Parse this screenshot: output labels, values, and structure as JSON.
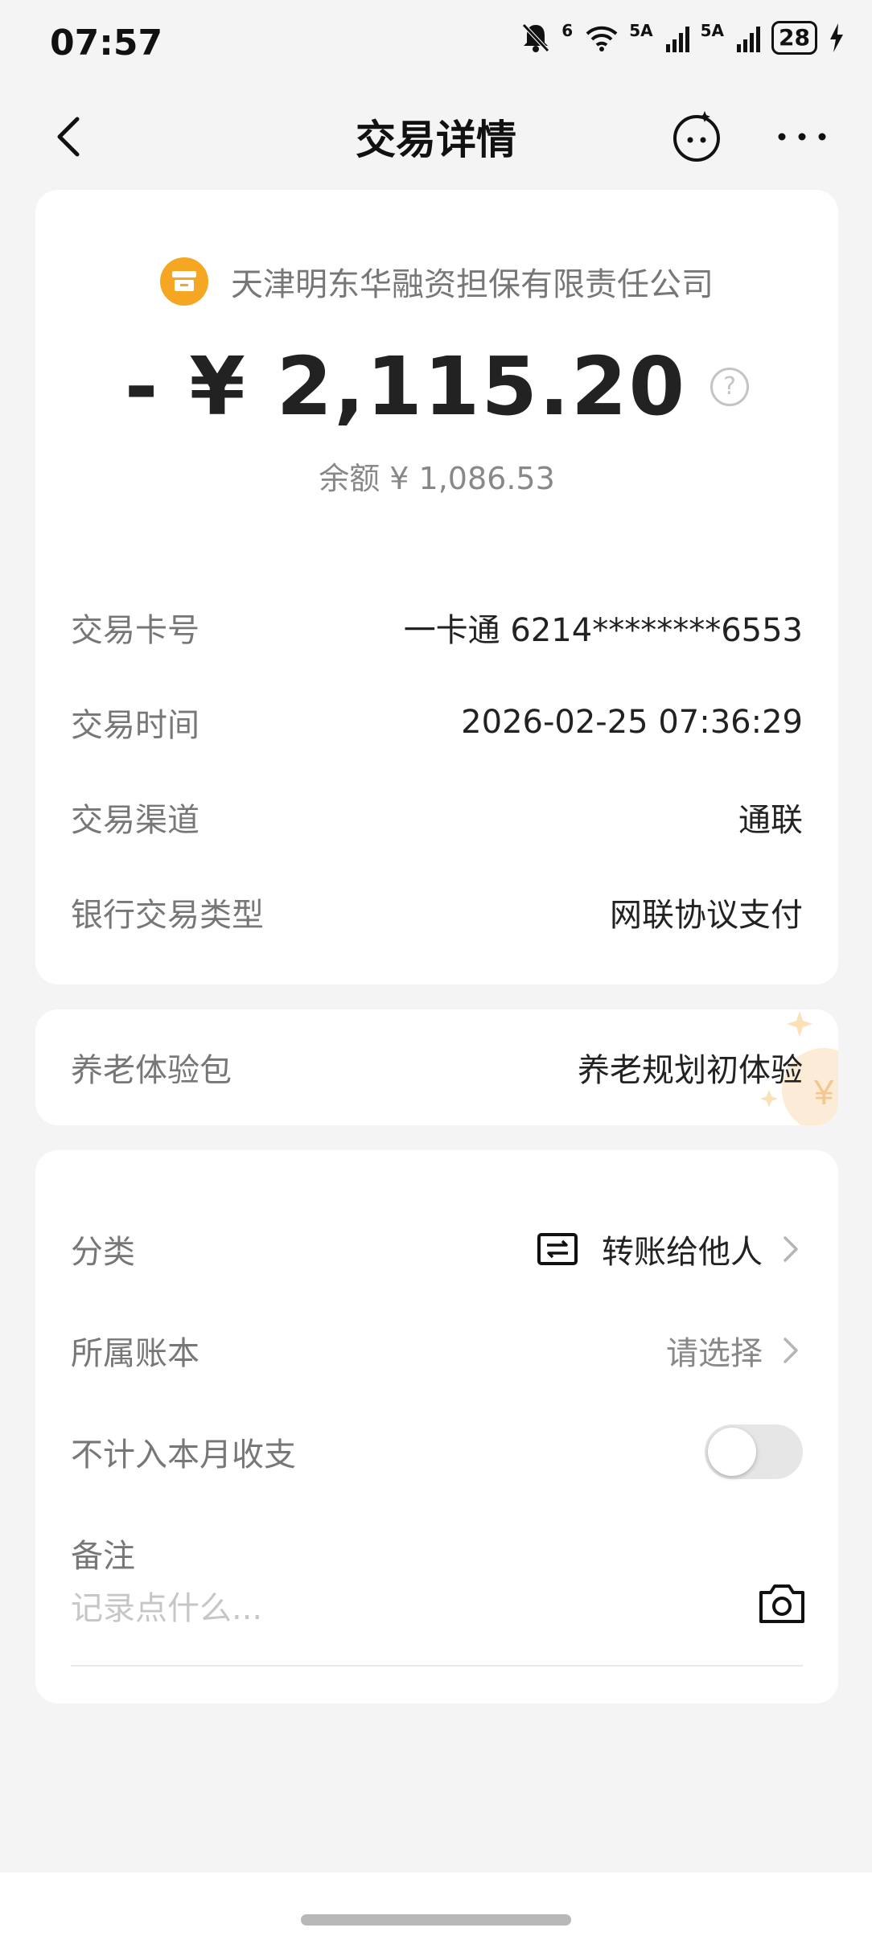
{
  "status_bar": {
    "time": "07:57",
    "network_1": "6",
    "network_2": "5A",
    "network_3": "5A",
    "battery": "28",
    "icons": [
      "mute-bell-icon",
      "wifi-icon",
      "signal-icon",
      "signal-icon",
      "battery-icon",
      "charging-icon"
    ]
  },
  "nav": {
    "title": "交易详情",
    "icons": [
      "back-icon",
      "face-assistant-icon",
      "more-icon"
    ]
  },
  "transaction": {
    "merchant": "天津明东华融资担保有限责任公司",
    "amount": "- ¥ 2,115.20",
    "balance": "余额 ¥ 1,086.53",
    "details": [
      {
        "label": "交易卡号",
        "value": "一卡通 6214********6553"
      },
      {
        "label": "交易时间",
        "value": "2026-02-25 07:36:29"
      },
      {
        "label": "交易渠道",
        "value": "通联"
      },
      {
        "label": "银行交易类型",
        "value": "网联协议支付"
      }
    ]
  },
  "pension": {
    "label": "养老体验包",
    "value": "养老规划初体验"
  },
  "settings": {
    "category_label": "分类",
    "category_value": "转账给他人",
    "ledger_label": "所属账本",
    "ledger_value": "请选择",
    "exclude_label": "不计入本月收支",
    "exclude_on": false,
    "note_label": "备注",
    "note_placeholder": "记录点什么...",
    "note_value": ""
  },
  "colors": {
    "merchant_icon": "#f5a623",
    "background": "#f4f4f4",
    "card": "#ffffff"
  }
}
